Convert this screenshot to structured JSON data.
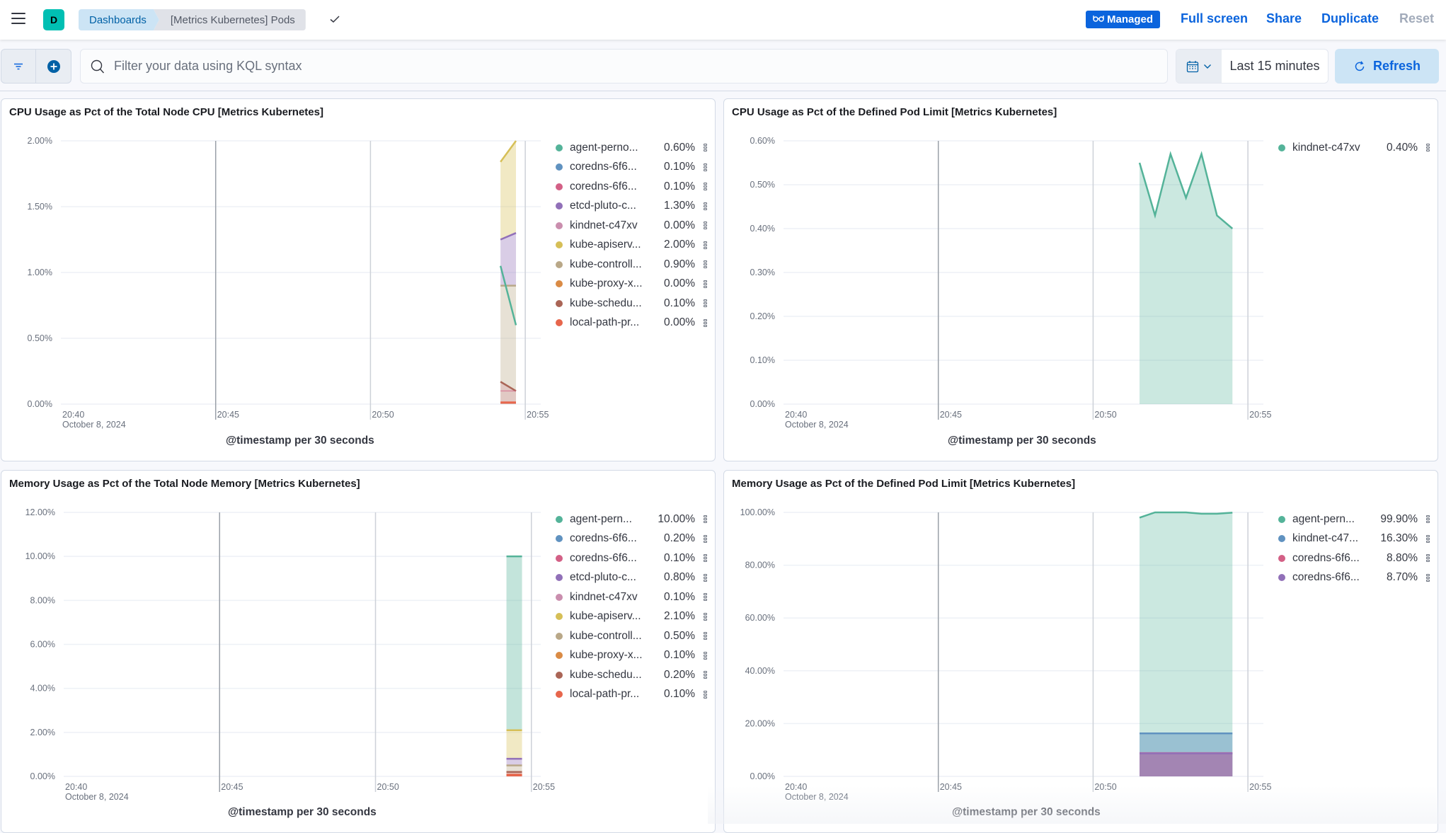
{
  "header": {
    "space_initial": "D",
    "breadcrumbs": [
      "Dashboards",
      "[Metrics Kubernetes] Pods"
    ],
    "managed_badge": "Managed",
    "links": {
      "full_screen": "Full screen",
      "share": "Share",
      "duplicate": "Duplicate",
      "reset": "Reset"
    }
  },
  "filter_bar": {
    "query_placeholder": "Filter your data using KQL syntax",
    "time_range": "Last 15 minutes",
    "refresh_label": "Refresh"
  },
  "colors": {
    "accent": "#0b64dd",
    "palette": [
      "#54b399",
      "#6092c0",
      "#d36086",
      "#9170b8",
      "#ca8eae",
      "#d6bf57",
      "#b9a888",
      "#da8b45",
      "#aa6556",
      "#e7664c"
    ]
  },
  "chart_data": [
    {
      "type": "area",
      "stacked": true,
      "title": "CPU Usage as Pct of the Total Node CPU [Metrics Kubernetes]",
      "xlabel": "@timestamp per 30 seconds",
      "x_ticks": [
        "20:40",
        "20:45",
        "20:50",
        "20:55"
      ],
      "x_date": "October 8, 2024",
      "y_ticks": [
        "0.00%",
        "0.50%",
        "1.00%",
        "1.50%",
        "2.00%"
      ],
      "ylim": [
        0,
        2.0
      ],
      "x_range_min": [
        0,
        15.5
      ],
      "x_points_min": [
        14.2,
        14.7
      ],
      "grid": true,
      "legend": "right",
      "series": [
        {
          "name": "agent-perno...",
          "legend_value": "0.60%",
          "color": "#54b399",
          "values": [
            1.05,
            0.6
          ]
        },
        {
          "name": "coredns-6f6...",
          "legend_value": "0.10%",
          "color": "#6092c0",
          "values": [
            0.1,
            0.1
          ]
        },
        {
          "name": "coredns-6f6...",
          "legend_value": "0.10%",
          "color": "#d36086",
          "values": [
            0.1,
            0.1
          ]
        },
        {
          "name": "etcd-pluto-c...",
          "legend_value": "1.30%",
          "color": "#9170b8",
          "values": [
            1.25,
            1.3
          ]
        },
        {
          "name": "kindnet-c47xv",
          "legend_value": "0.00%",
          "color": "#ca8eae",
          "values": [
            0.0,
            0.0
          ]
        },
        {
          "name": "kube-apiserv...",
          "legend_value": "2.00%",
          "color": "#d6bf57",
          "values": [
            1.84,
            2.0
          ]
        },
        {
          "name": "kube-controll...",
          "legend_value": "0.90%",
          "color": "#b9a888",
          "values": [
            0.9,
            0.9
          ]
        },
        {
          "name": "kube-proxy-x...",
          "legend_value": "0.00%",
          "color": "#da8b45",
          "values": [
            0.0,
            0.0
          ]
        },
        {
          "name": "kube-schedu...",
          "legend_value": "0.10%",
          "color": "#aa6556",
          "values": [
            0.17,
            0.1
          ]
        },
        {
          "name": "local-path-pr...",
          "legend_value": "0.00%",
          "color": "#e7664c",
          "values": [
            0.0,
            0.0
          ]
        }
      ],
      "cumulative_bands": [
        [
          0.17,
          0.1
        ],
        [
          0.9,
          0.9
        ],
        [
          1.25,
          1.3
        ],
        [
          1.84,
          2.0
        ]
      ]
    },
    {
      "type": "area",
      "stacked": false,
      "title": "CPU Usage as Pct of the Defined Pod Limit [Metrics Kubernetes]",
      "xlabel": "@timestamp per 30 seconds",
      "x_ticks": [
        "20:40",
        "20:45",
        "20:50",
        "20:55"
      ],
      "x_date": "October 8, 2024",
      "y_ticks": [
        "0.00%",
        "0.10%",
        "0.20%",
        "0.30%",
        "0.40%",
        "0.50%",
        "0.60%"
      ],
      "ylim": [
        0,
        0.6
      ],
      "x_range_min": [
        0,
        15.5
      ],
      "x_points_min": [
        11.5,
        12.0,
        12.5,
        13.0,
        13.5,
        14.0,
        14.5
      ],
      "grid": true,
      "legend": "right",
      "series": [
        {
          "name": "kindnet-c47xv",
          "legend_value": "0.40%",
          "color": "#54b399",
          "values": [
            0.55,
            0.43,
            0.57,
            0.47,
            0.57,
            0.43,
            0.4
          ]
        }
      ]
    },
    {
      "type": "area",
      "stacked": true,
      "title": "Memory Usage as Pct of the Total Node Memory [Metrics Kubernetes]",
      "xlabel": "@timestamp per 30 seconds",
      "x_ticks": [
        "20:40",
        "20:45",
        "20:50",
        "20:55"
      ],
      "x_date": "October 8, 2024",
      "y_ticks": [
        "0.00%",
        "2.00%",
        "4.00%",
        "6.00%",
        "8.00%",
        "10.00%",
        "12.00%"
      ],
      "ylim": [
        0,
        12
      ],
      "x_range_min": [
        0,
        15.3
      ],
      "x_points_min": [
        14.2,
        14.7
      ],
      "grid": true,
      "legend": "right",
      "series": [
        {
          "name": "agent-pern...",
          "legend_value": "10.00%",
          "color": "#54b399",
          "values": [
            10.0,
            10.0
          ]
        },
        {
          "name": "coredns-6f6...",
          "legend_value": "0.20%",
          "color": "#6092c0",
          "values": [
            0.2,
            0.2
          ]
        },
        {
          "name": "coredns-6f6...",
          "legend_value": "0.10%",
          "color": "#d36086",
          "values": [
            0.1,
            0.1
          ]
        },
        {
          "name": "etcd-pluto-c...",
          "legend_value": "0.80%",
          "color": "#9170b8",
          "values": [
            0.8,
            0.8
          ]
        },
        {
          "name": "kindnet-c47xv",
          "legend_value": "0.10%",
          "color": "#ca8eae",
          "values": [
            0.1,
            0.1
          ]
        },
        {
          "name": "kube-apiserv...",
          "legend_value": "2.10%",
          "color": "#d6bf57",
          "values": [
            2.1,
            2.1
          ]
        },
        {
          "name": "kube-controll...",
          "legend_value": "0.50%",
          "color": "#b9a888",
          "values": [
            0.5,
            0.5
          ]
        },
        {
          "name": "kube-proxy-x...",
          "legend_value": "0.10%",
          "color": "#da8b45",
          "values": [
            0.1,
            0.1
          ]
        },
        {
          "name": "kube-schedu...",
          "legend_value": "0.20%",
          "color": "#aa6556",
          "values": [
            0.2,
            0.2
          ]
        },
        {
          "name": "local-path-pr...",
          "legend_value": "0.10%",
          "color": "#e7664c",
          "values": [
            0.1,
            0.1
          ]
        }
      ],
      "cumulative_bands": [
        [
          0.2,
          0.2
        ],
        [
          0.5,
          0.5
        ],
        [
          0.8,
          0.8
        ],
        [
          2.1,
          2.1
        ],
        [
          10.0,
          10.0
        ]
      ]
    },
    {
      "type": "area",
      "stacked": false,
      "title": "Memory Usage as Pct of the Defined Pod Limit [Metrics Kubernetes]",
      "xlabel": "@timestamp per 30 seconds",
      "x_ticks": [
        "20:40",
        "20:45",
        "20:50",
        "20:55"
      ],
      "x_date": "October 8, 2024",
      "y_ticks": [
        "0.00%",
        "20.00%",
        "40.00%",
        "60.00%",
        "80.00%",
        "100.00%"
      ],
      "ylim": [
        0,
        100
      ],
      "x_range_min": [
        0,
        15.5
      ],
      "x_points_min": [
        11.5,
        12.0,
        12.5,
        13.0,
        13.5,
        14.0,
        14.5
      ],
      "grid": true,
      "legend": "right",
      "series": [
        {
          "name": "agent-pern...",
          "legend_value": "99.90%",
          "color": "#54b399",
          "values": [
            98,
            100,
            100,
            100,
            99.5,
            99.5,
            99.9
          ]
        },
        {
          "name": "kindnet-c47...",
          "legend_value": "16.30%",
          "color": "#6092c0",
          "values": [
            16.3,
            16.3,
            16.3,
            16.3,
            16.3,
            16.3,
            16.3
          ]
        },
        {
          "name": "coredns-6f6...",
          "legend_value": "8.80%",
          "color": "#d36086",
          "values": [
            8.8,
            8.8,
            8.8,
            8.8,
            8.8,
            8.8,
            8.8
          ]
        },
        {
          "name": "coredns-6f6...",
          "legend_value": "8.70%",
          "color": "#9170b8",
          "values": [
            8.7,
            8.7,
            8.7,
            8.7,
            8.7,
            8.7,
            8.7
          ]
        }
      ]
    }
  ]
}
